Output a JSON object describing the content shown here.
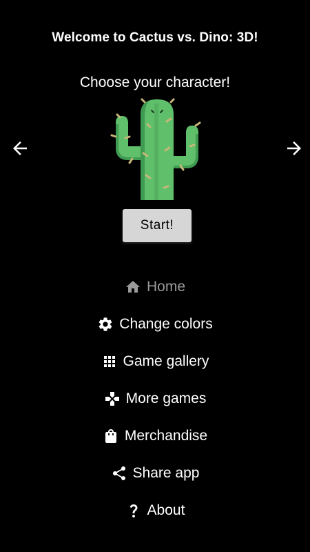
{
  "header": {
    "title": "Welcome to Cactus vs. Dino: 3D!",
    "subtitle": "Choose your character!"
  },
  "carousel": {
    "prev_icon": "arrow-left-icon",
    "next_icon": "arrow-right-icon",
    "current_character": "cactus-icon"
  },
  "start_button": {
    "label": "Start!"
  },
  "menu": {
    "items": [
      {
        "label": "Home",
        "icon": "home-icon",
        "active": true
      },
      {
        "label": "Change colors",
        "icon": "gear-icon",
        "active": false
      },
      {
        "label": "Game gallery",
        "icon": "grid-icon",
        "active": false
      },
      {
        "label": "More games",
        "icon": "gamepad-icon",
        "active": false
      },
      {
        "label": "Merchandise",
        "icon": "shopping-bag-icon",
        "active": false
      },
      {
        "label": "Share app",
        "icon": "share-icon",
        "active": false
      },
      {
        "label": "About",
        "icon": "question-icon",
        "active": false
      }
    ]
  },
  "colors": {
    "background": "#000000",
    "text": "#ffffff",
    "active_menu_text": "#9a9a9a",
    "button_bg": "#d6d6d6",
    "cactus_green": "#5fbf6a",
    "cactus_dark": "#3f9a52",
    "spine": "#c8b67a"
  }
}
